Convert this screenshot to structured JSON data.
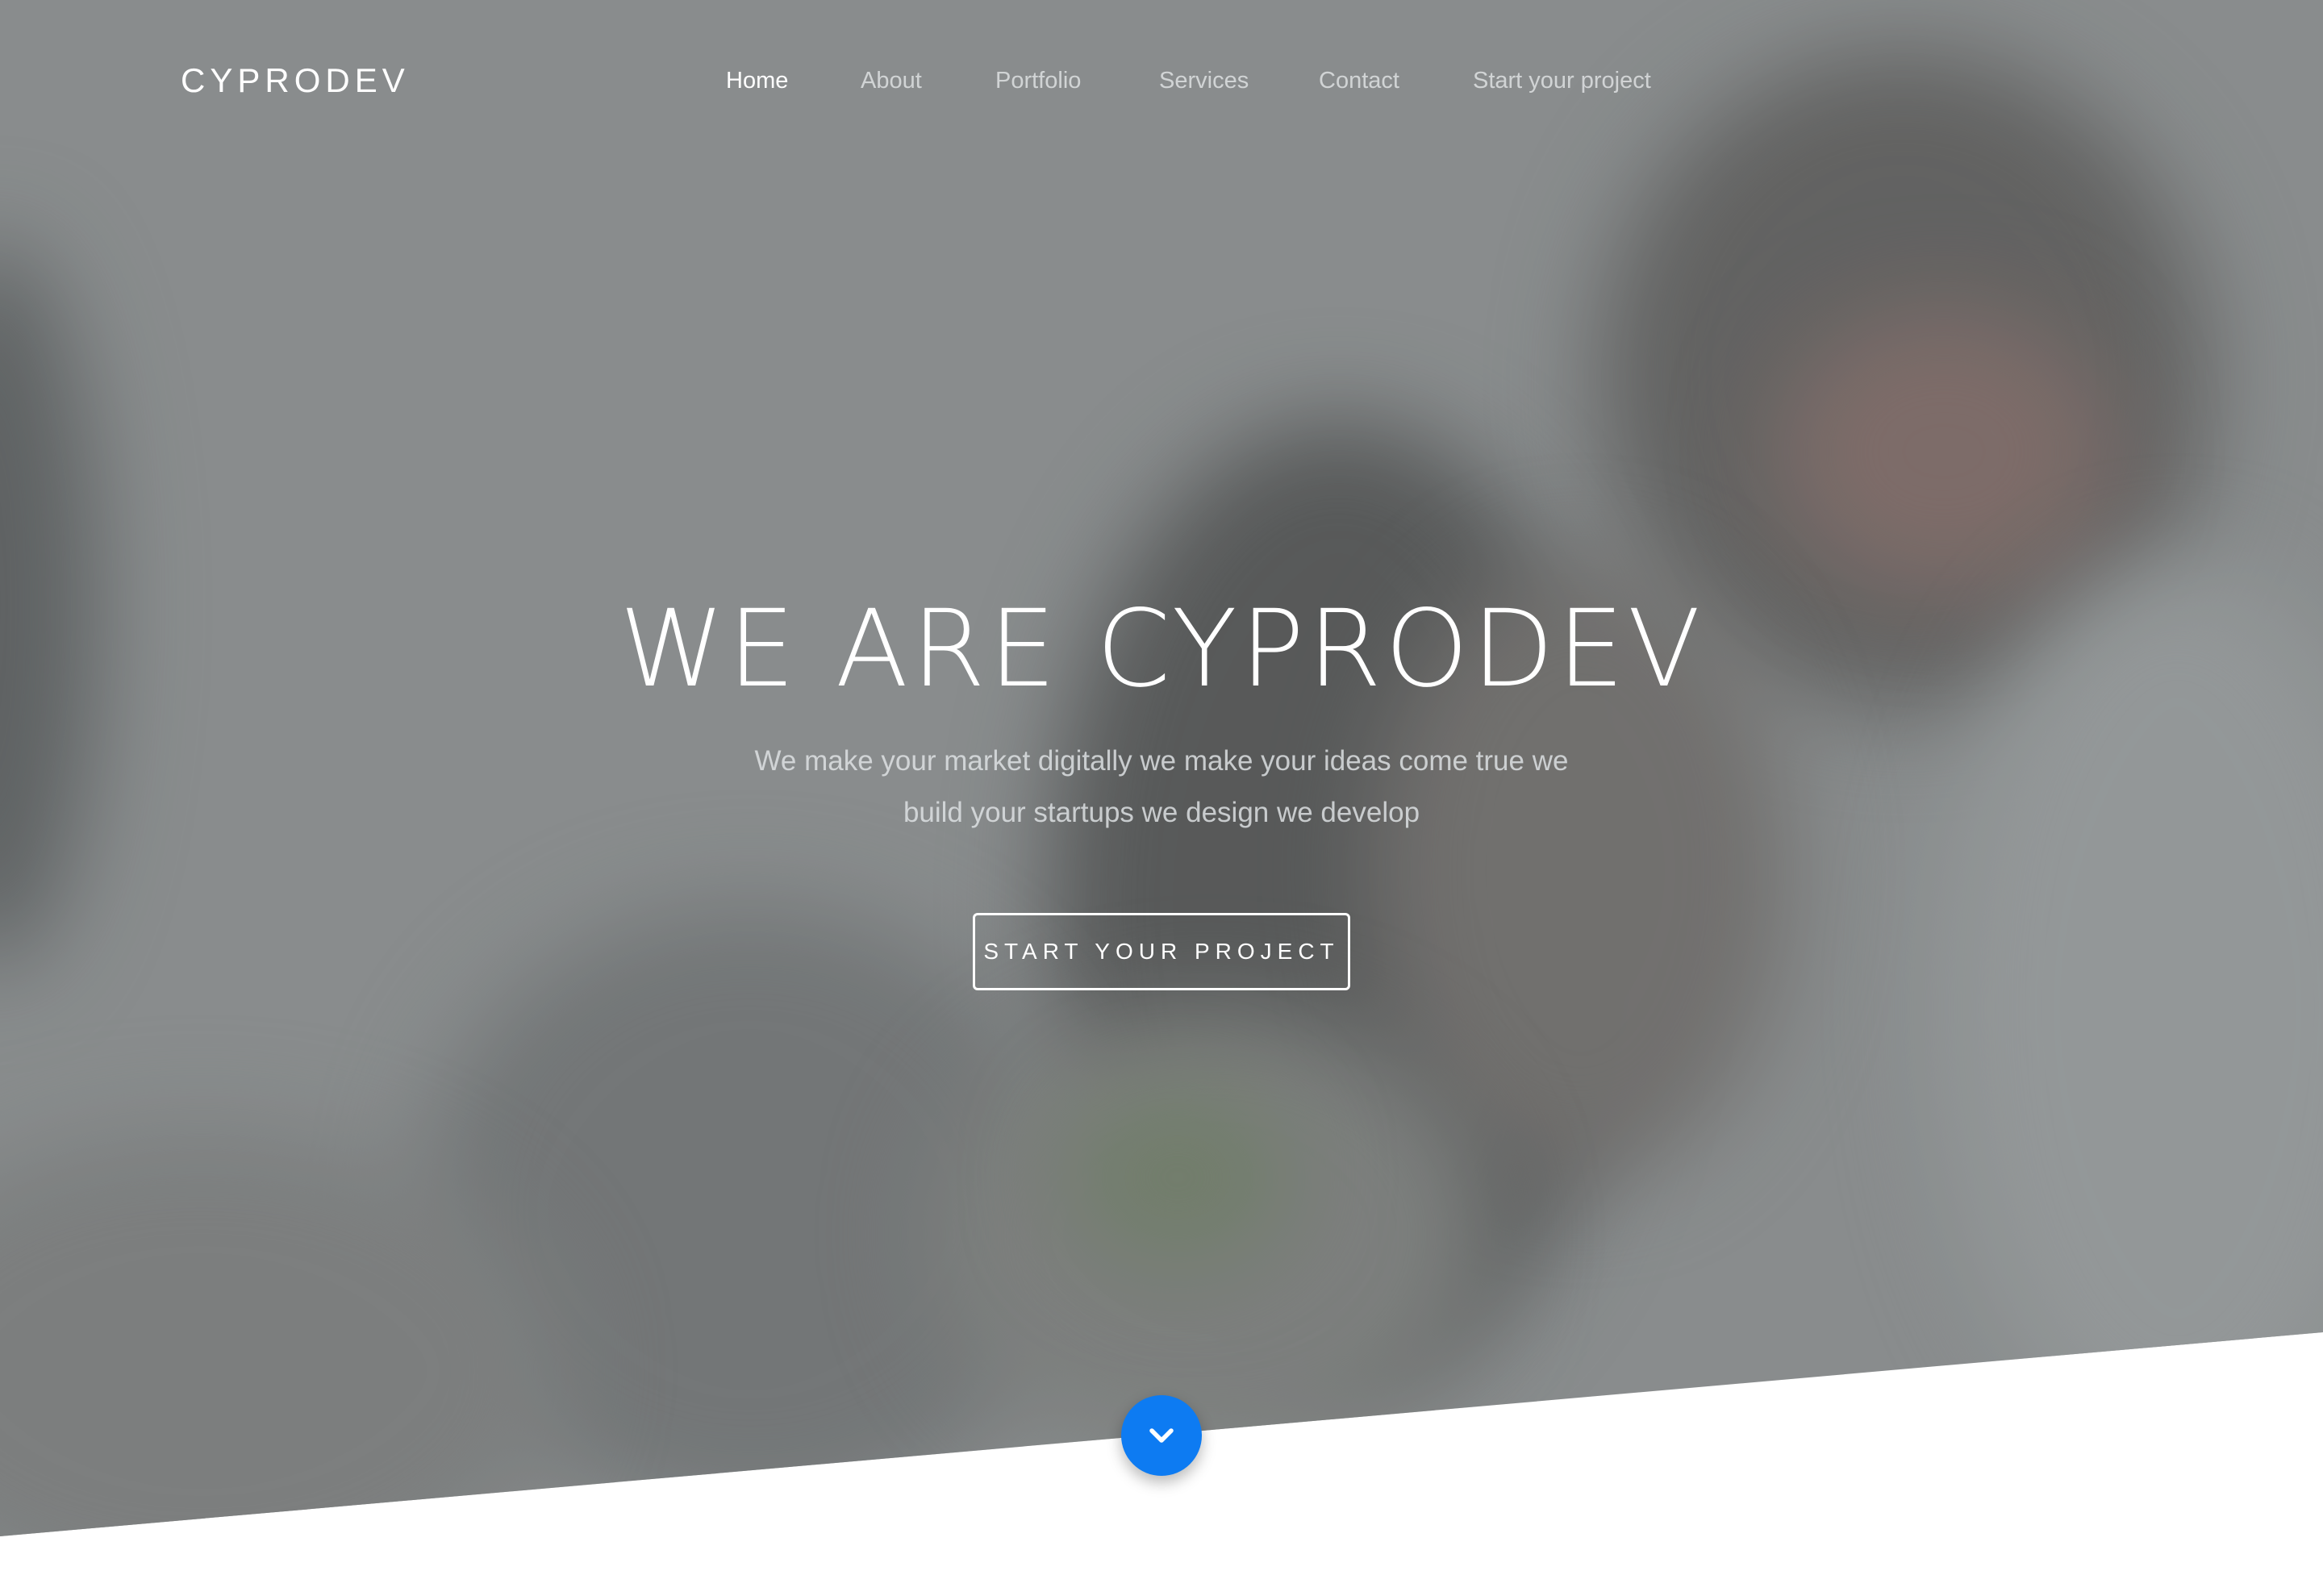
{
  "brand": {
    "name": "CYPRODEV"
  },
  "nav": {
    "items": [
      {
        "label": "Home",
        "active": true
      },
      {
        "label": "About",
        "active": false
      },
      {
        "label": "Portfolio",
        "active": false
      },
      {
        "label": "Services",
        "active": false
      },
      {
        "label": "Contact",
        "active": false
      },
      {
        "label": "Start your project",
        "active": false
      }
    ]
  },
  "hero": {
    "title": "WE ARE CYPRODEV",
    "subtitle": "We make your market digitally we make your ideas come true we build your startups we design we develop",
    "cta_label": "START YOUR PROJECT"
  },
  "scroll": {
    "icon": "chevron-down-icon",
    "color": "#0d7bf2"
  }
}
